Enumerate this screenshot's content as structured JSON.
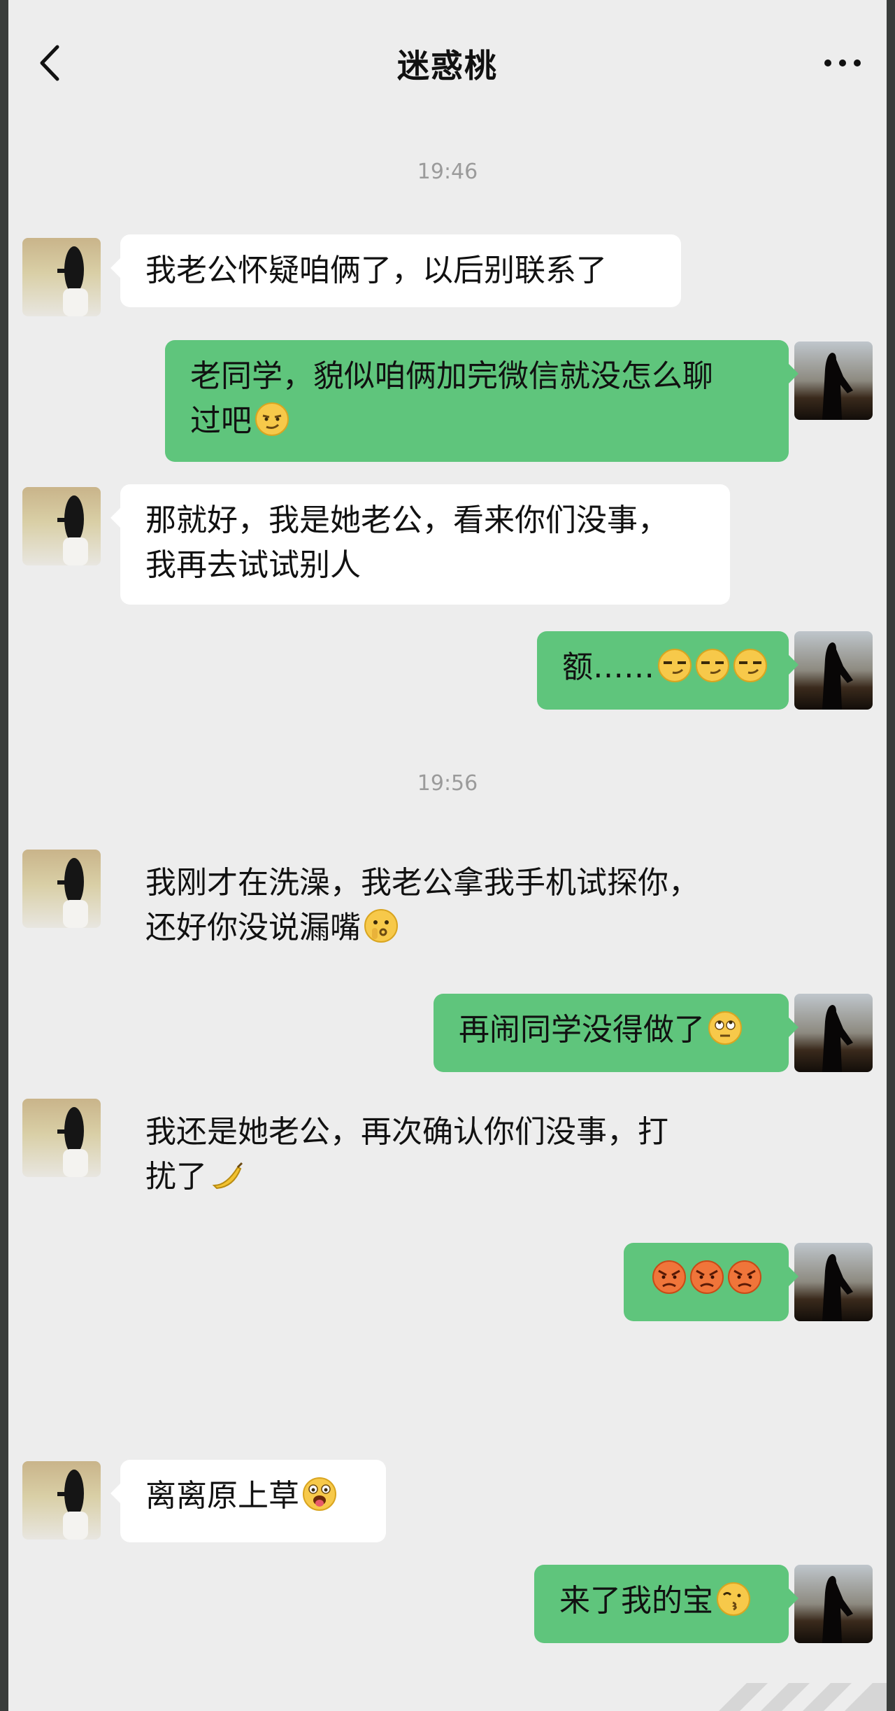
{
  "header": {
    "title": "迷惑桃"
  },
  "colors": {
    "background": "#ededed",
    "incoming_bubble": "#ffffff",
    "outgoing_bubble": "#5fc57c"
  },
  "timestamps": [
    "19:46",
    "19:56"
  ],
  "messages": [
    {
      "from": "contact",
      "lines": [
        "我老公怀疑咱俩了，以后别联系了"
      ]
    },
    {
      "from": "me",
      "lines": [
        "老同学，貌似咱俩加完微信就没怎么聊",
        "过吧"
      ],
      "emojis": [
        "smirk-emoji"
      ]
    },
    {
      "from": "contact",
      "lines": [
        "那就好，我是她老公，看来你们没事，",
        "我再去试试别人"
      ]
    },
    {
      "from": "me",
      "lines": [
        "额……"
      ],
      "emojis": [
        "sly-emoji",
        "sly-emoji",
        "sly-emoji"
      ]
    },
    {
      "from": "contact",
      "lines": [
        "我刚才在洗澡，我老公拿我手机试探你，",
        "还好你没说漏嘴"
      ],
      "emojis": [
        "shush-emoji"
      ]
    },
    {
      "from": "me",
      "lines": [
        "再闹同学没得做了"
      ],
      "emojis": [
        "eye-roll-emoji"
      ]
    },
    {
      "from": "contact",
      "lines": [
        "我还是她老公，再次确认你们没事，打",
        "扰了"
      ],
      "emojis": [
        "banana-emoji"
      ]
    },
    {
      "from": "me",
      "lines": [
        ""
      ],
      "emojis": [
        "angry-emoji",
        "angry-emoji",
        "angry-emoji"
      ]
    },
    {
      "from": "contact",
      "lines": [
        "离离原上草"
      ],
      "emojis": [
        "tongue-emoji"
      ]
    },
    {
      "from": "me",
      "lines": [
        "来了我的宝"
      ],
      "emojis": [
        "kiss-emoji"
      ]
    }
  ]
}
